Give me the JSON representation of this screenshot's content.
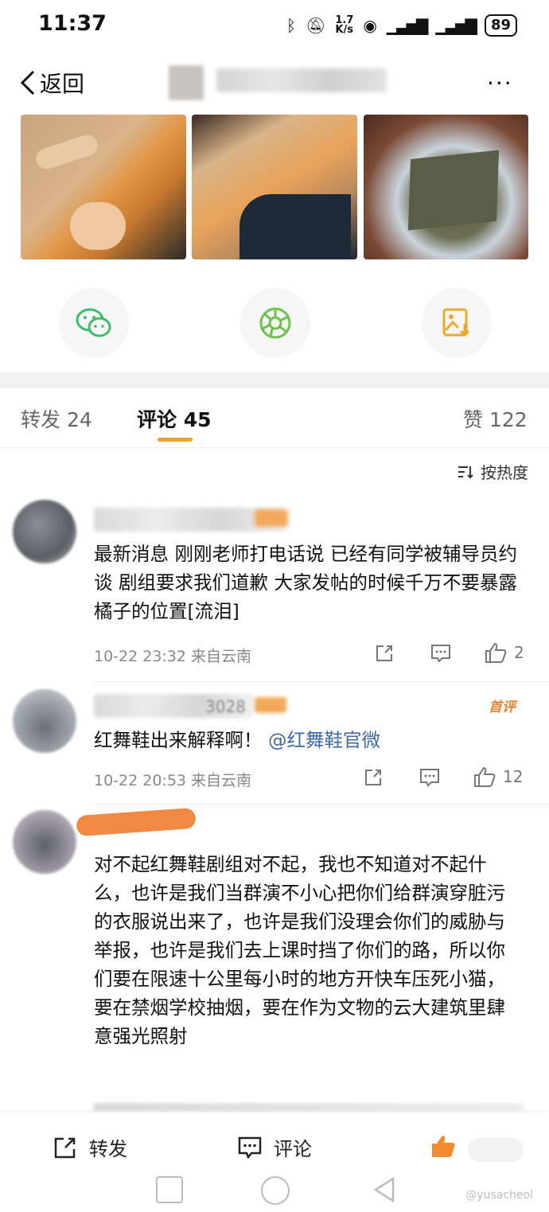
{
  "status_bar": {
    "time": "11:37",
    "net_speed": "1.7\nK/s",
    "battery": "89"
  },
  "nav": {
    "back_label": "返回",
    "more_label": "···"
  },
  "tabs": [
    {
      "label": "转发",
      "count": "24"
    },
    {
      "label": "评论",
      "count": "45"
    },
    {
      "label": "赞",
      "count": "122"
    }
  ],
  "sort_label": "按热度",
  "comments": [
    {
      "text": "最新消息 刚刚老师打电话说 已经有同学被辅导员约谈 剧组要求我们道歉 大家发帖的时候千万不要暴露橘子的位置[流泪]",
      "meta": "10-22 23:32 来自云南",
      "likes": "2"
    },
    {
      "name_suffix": "3028",
      "badge": "首评",
      "text_prefix": "红舞鞋出来解释啊！",
      "mention": "@红舞鞋官微",
      "meta": "10-22 20:53 来自云南",
      "likes": "12"
    },
    {
      "text": "对不起红舞鞋剧组对不起，我也不知道对不起什么，也许是我们当群演不小心把你们给群演穿脏污的衣服说出来了，也许是我们没理会你们的威胁与举报，也许是我们去上课时挡了你们的路，所以你们要在限速十公里每小时的地方开快车压死小猫，要在禁烟学校抽烟，要在作为文物的云大建筑里肆意强光照射"
    }
  ],
  "bottom_bar": {
    "repost": "转发",
    "comment": "评论"
  },
  "credit": "@yusacheol",
  "colors": {
    "accent": "#f2a22a",
    "mention": "#3d6aa5",
    "wechat": "#3fbe6b"
  }
}
